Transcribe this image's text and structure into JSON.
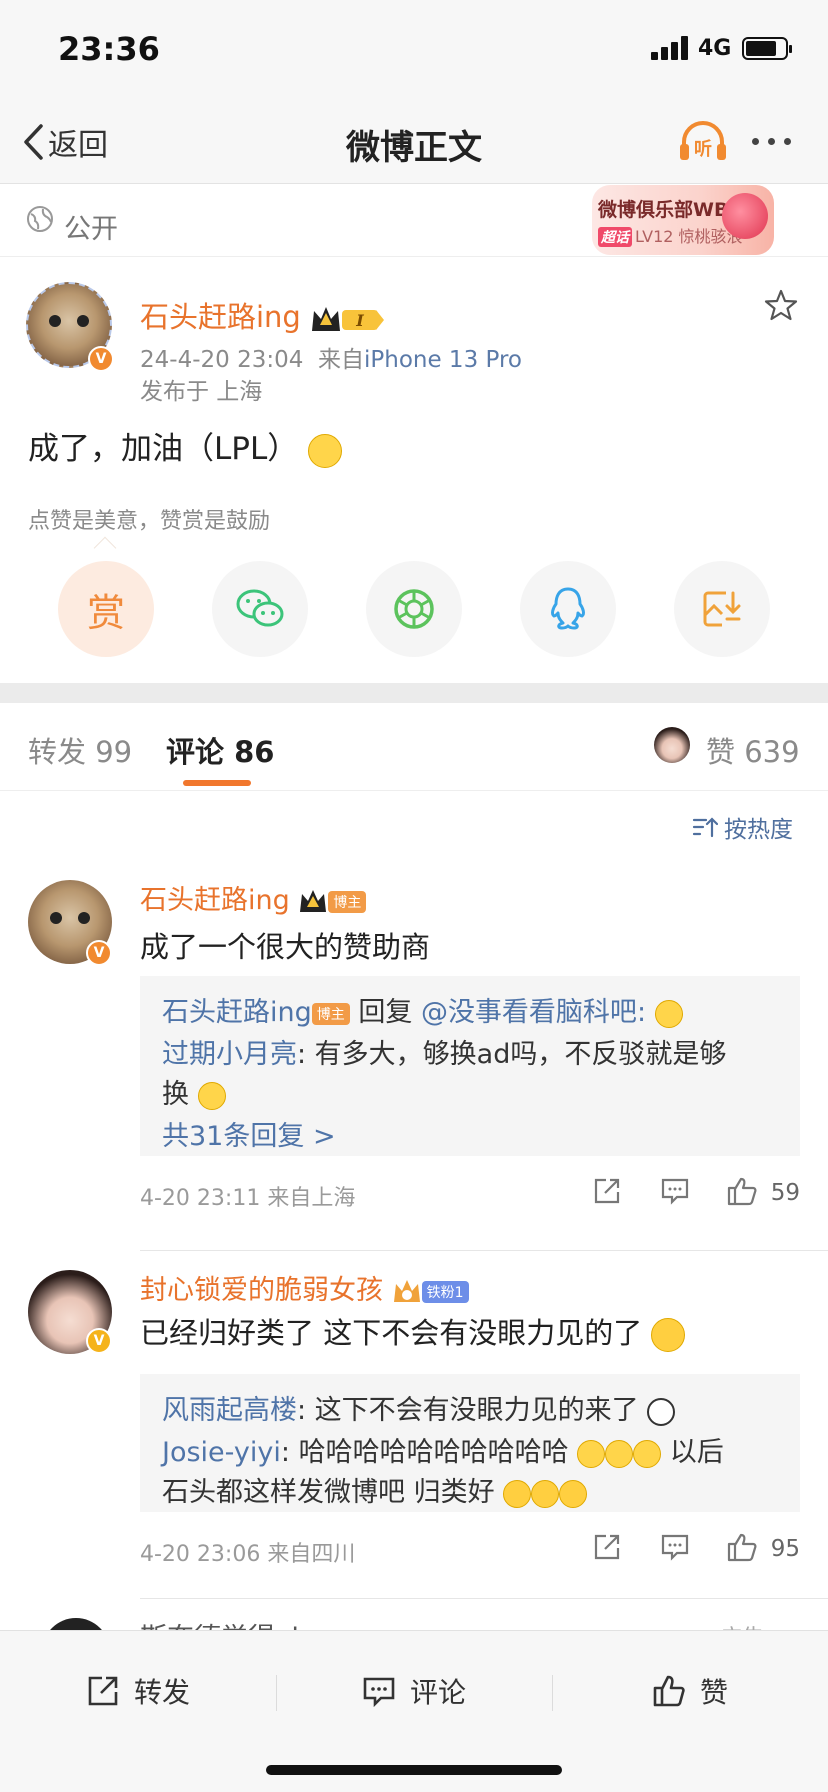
{
  "status": {
    "time": "23:36",
    "network": "4G"
  },
  "nav": {
    "back": "返回",
    "title": "微博正文",
    "listen": "听"
  },
  "visibility": {
    "label": "公开"
  },
  "club_banner": {
    "title": "微博俱乐部WB...",
    "tag": "超话",
    "level": "LV12 惊桃骇浪"
  },
  "post": {
    "author": "石头赶路ing",
    "rank_badge": "I",
    "time": "24-4-20 23:04",
    "source_prefix": "来自",
    "device": "iPhone 13 Pro",
    "location": "发布于 上海",
    "text": "成了，加油（LPL）",
    "reward_hint": "点赞是美意，赞赏是鼓励",
    "reward_label": "赏"
  },
  "tabs": {
    "repost_label": "转发",
    "repost_count": "99",
    "comment_label": "评论",
    "comment_count": "86",
    "like_label": "赞",
    "like_count": "639"
  },
  "sort_label": "按热度",
  "comments": [
    {
      "name": "石头赶路ing",
      "badge": "博主",
      "text": "成了一个很大的赞助商",
      "replies": [
        {
          "name": "石头赶路ing",
          "badge": "博主",
          "text": " 回复 ",
          "mention": "@没事看看脑科吧",
          "tail": ":"
        },
        {
          "name": "过期小月亮",
          "text": ": 有多大，够换ad吗，不反驳就是够",
          "text2": "换"
        }
      ],
      "more": "共31条回复 >",
      "time": "4-20 23:11 来自上海",
      "likes": "59"
    },
    {
      "name": "封心锁爱的脆弱女孩",
      "badge": "铁粉1",
      "text": "已经归好类了 这下不会有没眼力见的了",
      "replies": [
        {
          "name": "风雨起高楼",
          "text": ": 这下不会有没眼力见的来了"
        },
        {
          "name": "Josie-yiyi",
          "text": ": 哈哈哈哈哈哈哈哈哈哈",
          "text_after": " 以后",
          "text2": "石头都这样发微博吧 归类好"
        }
      ],
      "time": "4-20 23:06 来自四川",
      "likes": "95"
    }
  ],
  "peek": {
    "name": "斯奈德觉得ok",
    "ad": "广告"
  },
  "bottom": {
    "repost": "转发",
    "comment": "评论",
    "like": "赞"
  },
  "colors": {
    "accent": "#f1772d",
    "link": "#4f74a8",
    "name": "#e8732c"
  }
}
